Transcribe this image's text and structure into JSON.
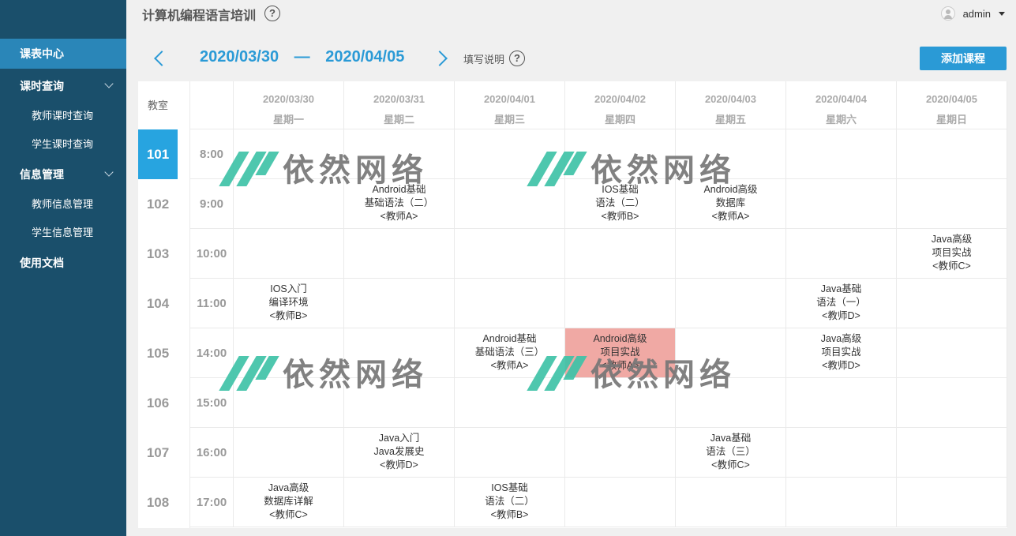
{
  "header": {
    "title": "计算机编程语言培训",
    "help_glyph": "?",
    "user": "admin"
  },
  "sidebar": {
    "items": [
      {
        "label": "课表中心"
      },
      {
        "label": "课时查询"
      },
      {
        "label": "教师课时查询"
      },
      {
        "label": "学生课时查询"
      },
      {
        "label": "信息管理"
      },
      {
        "label": "教师信息管理"
      },
      {
        "label": "学生信息管理"
      },
      {
        "label": "使用文档"
      }
    ]
  },
  "week": {
    "start": "2020/03/30",
    "sep": "—",
    "end": "2020/04/05",
    "note": "填写说明",
    "add_label": "添加课程"
  },
  "schedule": {
    "room_header": "教室",
    "days": [
      {
        "date": "2020/03/30",
        "weekday": "星期一"
      },
      {
        "date": "2020/03/31",
        "weekday": "星期二"
      },
      {
        "date": "2020/04/01",
        "weekday": "星期三"
      },
      {
        "date": "2020/04/02",
        "weekday": "星期四"
      },
      {
        "date": "2020/04/03",
        "weekday": "星期五"
      },
      {
        "date": "2020/04/04",
        "weekday": "星期六"
      },
      {
        "date": "2020/04/05",
        "weekday": "星期日"
      }
    ],
    "rooms": [
      "101",
      "102",
      "103",
      "104",
      "105",
      "106",
      "107",
      "108"
    ],
    "times": [
      "8:00",
      "9:00",
      "10:00",
      "11:00",
      "14:00",
      "15:00",
      "16:00",
      "17:00"
    ],
    "entries": [
      {
        "row": 1,
        "col": 1,
        "lines": [
          "Android基础",
          "基础语法（二）",
          "<教师A>"
        ]
      },
      {
        "row": 1,
        "col": 3,
        "lines": [
          "IOS基础",
          "语法（二）",
          "<教师B>"
        ]
      },
      {
        "row": 1,
        "col": 4,
        "lines": [
          "Android高级",
          "数据库",
          "<教师A>"
        ]
      },
      {
        "row": 2,
        "col": 6,
        "lines": [
          "Java高级",
          "项目实战",
          "<教师C>"
        ]
      },
      {
        "row": 3,
        "col": 0,
        "lines": [
          "IOS入门",
          "编译环境",
          "<教师B>"
        ]
      },
      {
        "row": 3,
        "col": 5,
        "lines": [
          "Java基础",
          "语法（一）",
          "<教师D>"
        ]
      },
      {
        "row": 4,
        "col": 2,
        "lines": [
          "Android基础",
          "基础语法（三）",
          "<教师A>"
        ]
      },
      {
        "row": 4,
        "col": 3,
        "lines": [
          "Android高级",
          "项目实战",
          "<教师A>"
        ],
        "highlight": true
      },
      {
        "row": 4,
        "col": 5,
        "lines": [
          "Java高级",
          "项目实战",
          "<教师D>"
        ]
      },
      {
        "row": 6,
        "col": 1,
        "lines": [
          "Java入门",
          "Java发展史",
          "<教师D>"
        ]
      },
      {
        "row": 6,
        "col": 4,
        "lines": [
          "Java基础",
          "语法（三）",
          "<教师C>"
        ]
      },
      {
        "row": 7,
        "col": 0,
        "lines": [
          "Java高级",
          "数据库详解",
          "<教师C>"
        ]
      },
      {
        "row": 7,
        "col": 2,
        "lines": [
          "IOS基础",
          "语法（二）",
          "<教师B>"
        ]
      }
    ]
  },
  "watermark": {
    "text": "依然网络"
  },
  "colors": {
    "sidebar": "#1a4f6b",
    "accent": "#2a9ad6",
    "active_room": "#27a4e0",
    "highlight": "#f0a9a4"
  }
}
